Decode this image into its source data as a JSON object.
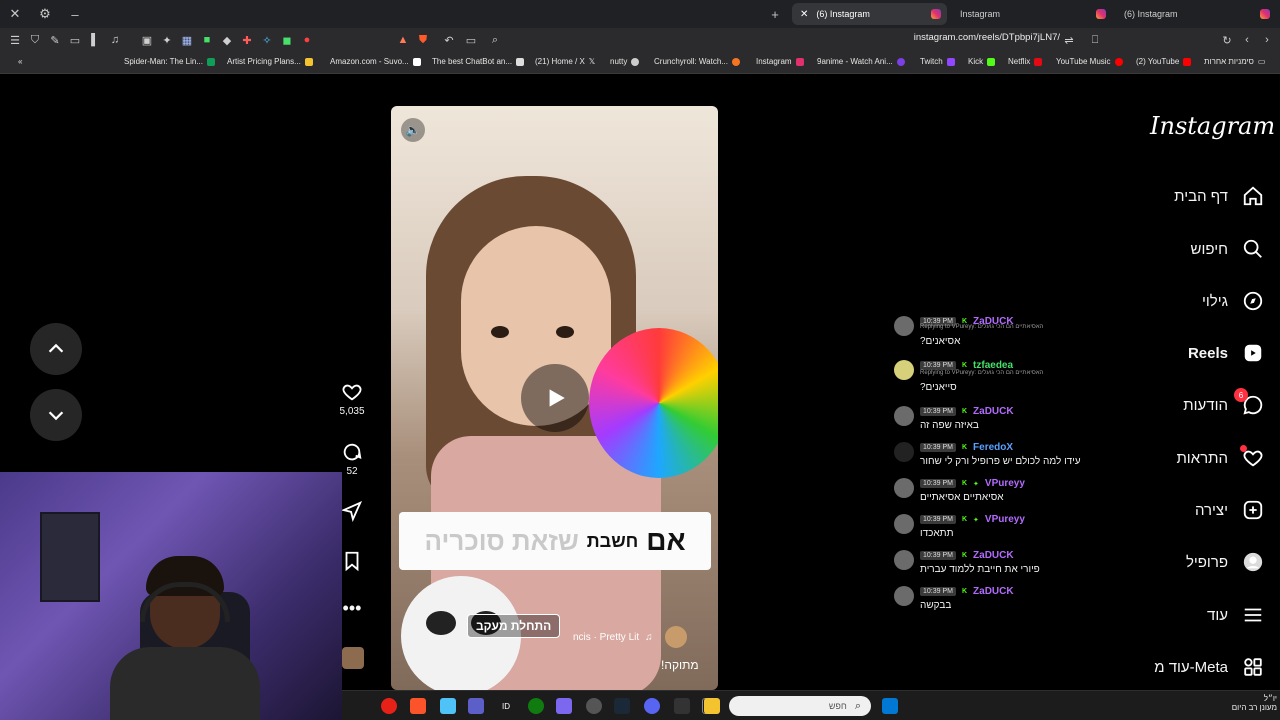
{
  "browser": {
    "tabs": [
      {
        "title": "(6) Instagram",
        "active": true
      },
      {
        "title": "Instagram",
        "active": false
      },
      {
        "title": "(6) Instagram",
        "active": false
      }
    ],
    "new_tab_label": "+",
    "url": "instagram.com/reels/DTpbpi7jLN7/",
    "bookmarks": [
      "Spider-Man: The Lin...",
      "Artist Pricing Plans...",
      "Amazon.com - Suvo...",
      "The best ChatBot an...",
      "(21) Home / X",
      "nutty",
      "Crunchyroll: Watch...",
      "Instagram",
      "9anime - Watch Ani...",
      "Twitch",
      "Kick",
      "Netflix",
      "YouTube Music",
      "(2) YouTube",
      "סימניות אחרות"
    ]
  },
  "instagram": {
    "logo": "Instagram",
    "nav": [
      {
        "label": "דף הבית",
        "icon": "home-icon"
      },
      {
        "label": "חיפוש",
        "icon": "search-icon"
      },
      {
        "label": "גילוי",
        "icon": "explore-icon"
      },
      {
        "label": "Reels",
        "icon": "reels-icon"
      },
      {
        "label": "הודעות",
        "icon": "messages-icon",
        "badge": "6"
      },
      {
        "label": "התראות",
        "icon": "heart-icon"
      },
      {
        "label": "יצירה",
        "icon": "create-icon"
      },
      {
        "label": "פרופיל",
        "icon": "profile-icon"
      },
      {
        "label": "עוד",
        "icon": "menu-icon"
      },
      {
        "label": "Meta-עוד מ",
        "icon": "meta-apps-icon"
      }
    ],
    "reel": {
      "caption_prefix": "אם",
      "caption_mid": "חשבת",
      "caption_faded": "שזאת סוכריה",
      "sticker_text": "התחלת מעקב",
      "music": "ncis · Pretty Lit",
      "bottom_caption": "מתוקה!",
      "likes": "5,035",
      "comments": "52"
    }
  },
  "chat": [
    {
      "time": "10:39 PM",
      "user": "ZaDUCK",
      "color": "#b36bff",
      "reply": "Replying to VPureyy: האסיאתיים הם הכי גועלים",
      "text": "אסיאנים?"
    },
    {
      "time": "10:39 PM",
      "user": "tzfaedea",
      "color": "#46e06b",
      "reply": "Replying to VPureyy: האסיאתיים הם הכי גועלים",
      "text": "סייאנים?"
    },
    {
      "time": "10:39 PM",
      "user": "ZaDUCK",
      "color": "#b36bff",
      "reply": "",
      "text": "באיזה שפה זה"
    },
    {
      "time": "10:39 PM",
      "user": "FeredoX",
      "color": "#5aa0ff",
      "reply": "",
      "text": "עידו למה לכולם יש פרופיל ורק לי שחור"
    },
    {
      "time": "10:39 PM",
      "user": "VPureyy",
      "color": "#b36bff",
      "reply": "",
      "text": "אסיאתיים אסיאתיים"
    },
    {
      "time": "10:39 PM",
      "user": "VPureyy",
      "color": "#b36bff",
      "reply": "",
      "text": "תתאכדו"
    },
    {
      "time": "10:39 PM",
      "user": "ZaDUCK",
      "color": "#b36bff",
      "reply": "",
      "text": "פיורי את חייבת ללמוד עברית"
    },
    {
      "time": "10:39 PM",
      "user": "ZaDUCK",
      "color": "#b36bff",
      "reply": "",
      "text": "בבקשה"
    }
  ],
  "taskbar": {
    "search_placeholder": "חפש",
    "clock_time": "יו״ל",
    "clock_sub": "מעונן רב היום"
  }
}
